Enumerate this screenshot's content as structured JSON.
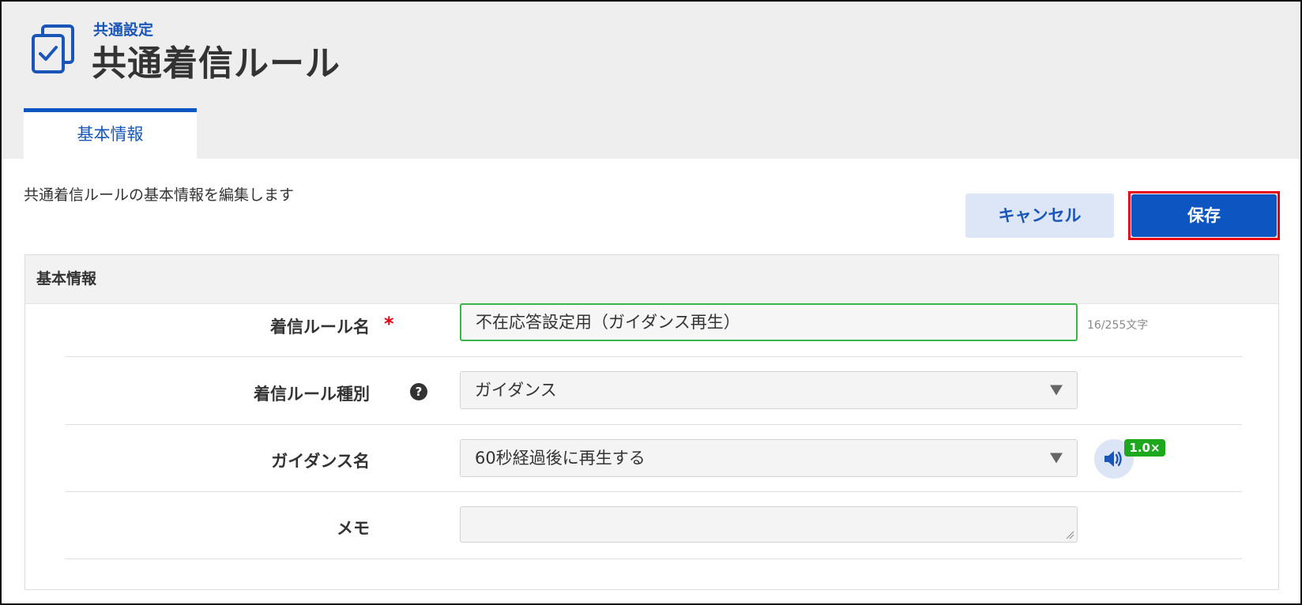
{
  "header": {
    "breadcrumb": "共通設定",
    "title": "共通着信ルール",
    "tabs": [
      {
        "label": "基本情報",
        "active": true
      }
    ]
  },
  "description": "共通着信ルールの基本情報を編集します",
  "actions": {
    "cancel_label": "キャンセル",
    "save_label": "保存"
  },
  "panel": {
    "title": "基本情報",
    "fields": {
      "rule_name": {
        "label": "着信ルール名",
        "required_mark": "*",
        "value": "不在応答設定用（ガイダンス再生）",
        "char_count": "16/255文字"
      },
      "rule_type": {
        "label": "着信ルール種別",
        "help_icon": "question-circle-icon",
        "value": "ガイダンス"
      },
      "guidance_name": {
        "label": "ガイダンス名",
        "value": "60秒経過後に再生する",
        "play_icon": "speaker-icon",
        "speed_badge": "1.0×"
      },
      "memo": {
        "label": "メモ",
        "value": ""
      }
    }
  },
  "colors": {
    "accent": "#0d56c2",
    "highlight_outline": "#e60012",
    "valid_border": "#3cb44b",
    "badge": "#1ea81e"
  }
}
